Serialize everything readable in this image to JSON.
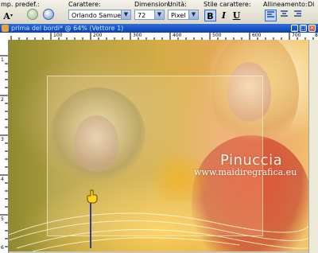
{
  "toolbar": {
    "preset_label": "mp. predef.:",
    "font_label": "Carattere:",
    "font_value": "Orlando Samuels",
    "size_label": "Dimensioni:",
    "size_value": "72",
    "unit_label": "Unità:",
    "unit_value": "Pixel",
    "style_label": "Stile carattere:",
    "align_label": "Allineamento:",
    "dir_label": "Di",
    "bold_glyph": "B",
    "italic_glyph": "I",
    "underline_glyph": "U",
    "text_tool_glyph": "A"
  },
  "document": {
    "title": "prima del bordi* @ 64% (Vettore 1)"
  },
  "rulers": {
    "top": [
      "100",
      "200",
      "300",
      "400",
      "500",
      "600",
      "700",
      "800"
    ],
    "left": [
      "1",
      "2",
      "3",
      "4",
      "5",
      "6"
    ]
  },
  "canvas": {
    "signature_name": "Pinuccia",
    "signature_url": "www.maidiregrafica.eu"
  },
  "colors": {
    "titlebar": "#0a3fb3",
    "toolbar_bg": "#ece9d8",
    "accent": "#316ac5"
  },
  "icons": {
    "cursor": "pointing-hand-icon",
    "confirm": "apply-icon",
    "cancel": "cancel-icon"
  }
}
